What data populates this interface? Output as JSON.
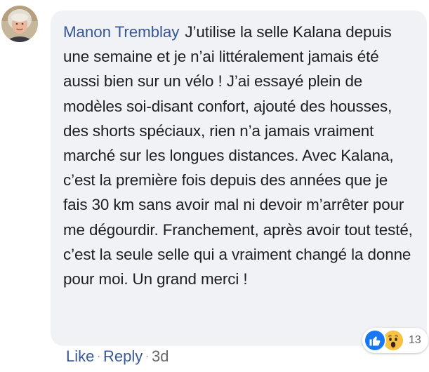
{
  "comment": {
    "author": "Manon Tremblay",
    "text": "J’utilise la selle Kalana depuis une semaine et je n’ai littéralement jamais été aussi bien sur un vélo ! J’ai essayé plein de modèles soi-disant confort, ajouté des housses, des shorts spéciaux, rien n’a jamais vraiment marché sur les longues distances. Avec Kalana, c’est la première fois depuis des années que je fais 30 km sans avoir mal ni devoir m’arrêter pour me dégourdir. Franchement, après avoir tout testé, c’est la seule selle qui a vraiment changé la donne pour moi. Un grand merci !",
    "reactions": {
      "icons": [
        "like-icon",
        "wow-icon"
      ],
      "count": "13",
      "colors": {
        "like": "#1877f2",
        "wow": "#f7c244"
      }
    }
  },
  "actions": {
    "like_label": "Like",
    "reply_label": "Reply",
    "separator": "·",
    "timestamp": "3d"
  },
  "colors": {
    "author": "#385898",
    "bubble": "#f0f2f5",
    "text": "#1c1e21",
    "meta": "#65676b"
  }
}
